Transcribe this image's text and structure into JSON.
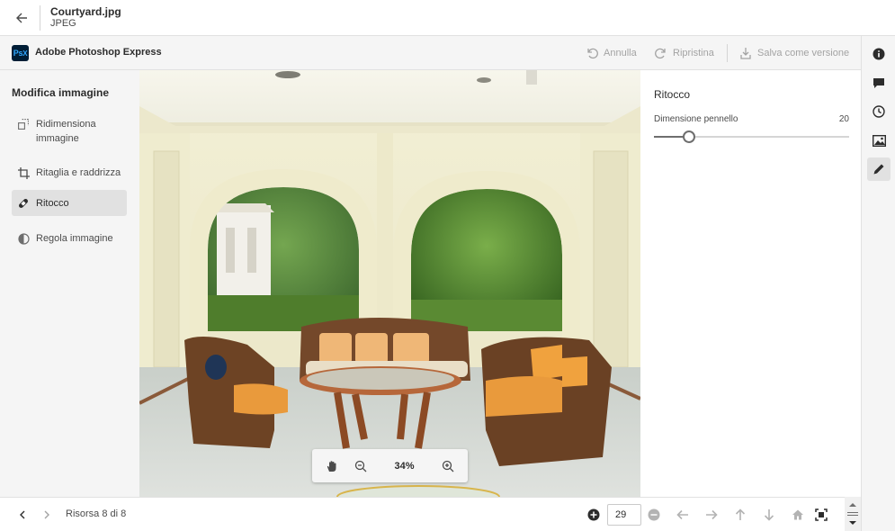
{
  "header": {
    "file_name": "Courtyard.jpg",
    "file_type": "JPEG"
  },
  "appbar": {
    "logo_text": "Ps",
    "logo_text_2": "X",
    "app_name": "Adobe Photoshop Express",
    "undo_label": "Annulla",
    "redo_label": "Ripristina",
    "save_label": "Salva come versione"
  },
  "left_panel": {
    "heading": "Modifica immagine",
    "tools": [
      {
        "label": "Ridimensiona immagine",
        "icon": "resize-icon"
      },
      {
        "label": "Ritaglia e raddrizza",
        "icon": "crop-icon"
      },
      {
        "label": "Ritocco",
        "icon": "heal-bandage-icon",
        "active": true
      },
      {
        "label": "Regola immagine",
        "icon": "adjust-icon"
      }
    ]
  },
  "canvas": {
    "zoom": "34%"
  },
  "properties": {
    "title": "Ritocco",
    "brush_label": "Dimensione pennello",
    "brush_value": "20",
    "brush_fraction": 0.18
  },
  "right_rail": [
    "info-icon",
    "comment-icon",
    "history-icon",
    "image-icon",
    "pencil-icon"
  ],
  "bottom": {
    "asset_count": "Risorsa 8 di 8",
    "page_value": "29"
  },
  "colors": {
    "accent": "#31a8ff",
    "panel_bg": "#f5f5f5",
    "text": "#2c2c2c",
    "disabled": "#a3a3a3"
  }
}
